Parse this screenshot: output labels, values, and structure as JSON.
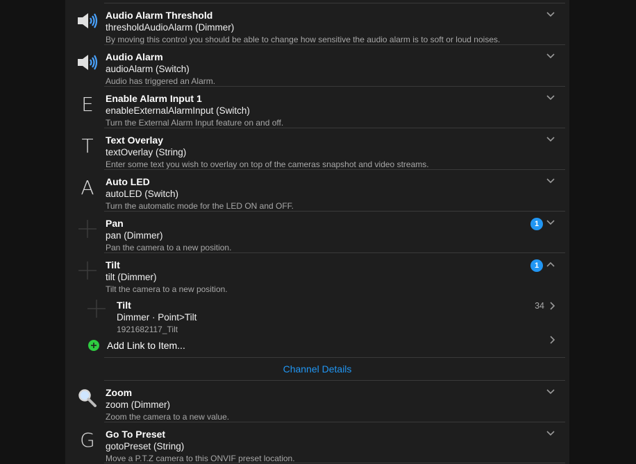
{
  "items": [
    {
      "title": "Audio Alarm Threshold",
      "sub": "thresholdAudioAlarm (Dimmer)",
      "desc": "By moving this control you should be able to change how sensitive the audio alarm is to soft or loud noises.",
      "icon": "speaker-icon"
    },
    {
      "title": "Audio Alarm",
      "sub": "audioAlarm (Switch)",
      "desc": "Audio has triggered an Alarm.",
      "icon": "speaker-icon"
    },
    {
      "title": "Enable Alarm Input 1",
      "sub": "enableExternalAlarmInput (Switch)",
      "desc": "Turn the External Alarm Input feature on and off.",
      "letter": "E"
    },
    {
      "title": "Text Overlay",
      "sub": "textOverlay (String)",
      "desc": "Enter some text you wish to overlay on top of the cameras snapshot and video streams.",
      "letter": "T"
    },
    {
      "title": "Auto LED",
      "sub": "autoLED (Switch)",
      "desc": "Turn the automatic mode for the LED ON and OFF.",
      "letter": "A"
    },
    {
      "title": "Pan",
      "sub": "pan (Dimmer)",
      "desc": "Pan the camera to a new position.",
      "badge": "1",
      "icon": "crosshair-icon"
    },
    {
      "title": "Tilt",
      "sub": "tilt (Dimmer)",
      "desc": "Tilt the camera to a new position.",
      "badge": "1",
      "icon": "crosshair-icon",
      "expanded": true
    }
  ],
  "tilt_link": {
    "title": "Tilt",
    "sub": "Dimmer · Point>Tilt",
    "id": "1921682117_Tilt",
    "count": "34"
  },
  "add_link_label": "Add Link to Item...",
  "channel_details_label": "Channel Details",
  "items_after": [
    {
      "title": "Zoom",
      "sub": "zoom (Dimmer)",
      "desc": "Zoom the camera to a new value.",
      "icon": "magnifier-icon"
    },
    {
      "title": "Go To Preset",
      "sub": "gotoPreset (String)",
      "desc": "Move a P.T.Z camera to this ONVIF preset location.",
      "letter": "G"
    }
  ],
  "colors": {
    "accent": "#2196f3",
    "add": "#2ecc40",
    "background": "#1e1e1e"
  }
}
